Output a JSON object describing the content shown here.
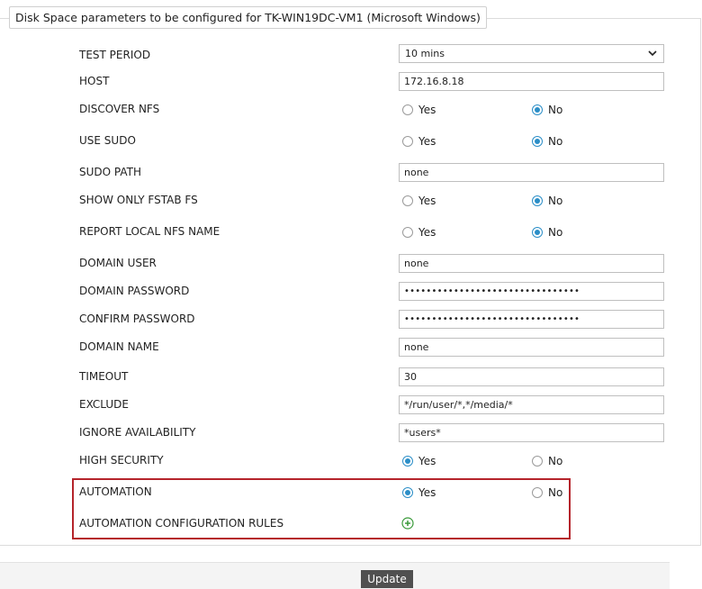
{
  "panel": {
    "title": "Disk Space parameters to be configured for TK-WIN19DC-VM1 (Microsoft Windows)"
  },
  "form": {
    "test_period": {
      "label": "TEST PERIOD",
      "value": "10 mins"
    },
    "host": {
      "label": "HOST",
      "value": "172.16.8.18"
    },
    "discover_nfs": {
      "label": "DISCOVER NFS",
      "yes": "Yes",
      "no": "No",
      "selected": "No"
    },
    "use_sudo": {
      "label": "USE SUDO",
      "yes": "Yes",
      "no": "No",
      "selected": "No"
    },
    "sudo_path": {
      "label": "SUDO PATH",
      "value": "none"
    },
    "show_only_fstab_fs": {
      "label": "SHOW ONLY FSTAB FS",
      "yes": "Yes",
      "no": "No",
      "selected": "No"
    },
    "report_local_nfs_name": {
      "label": "REPORT LOCAL NFS NAME",
      "yes": "Yes",
      "no": "No",
      "selected": "No"
    },
    "domain_user": {
      "label": "DOMAIN USER",
      "value": "none"
    },
    "domain_password": {
      "label": "DOMAIN PASSWORD",
      "value": "••••••••••••••••••••••••••••••••"
    },
    "confirm_password": {
      "label": "CONFIRM PASSWORD",
      "value": "••••••••••••••••••••••••••••••••"
    },
    "domain_name": {
      "label": "DOMAIN NAME",
      "value": "none"
    },
    "timeout": {
      "label": "TIMEOUT",
      "value": "30"
    },
    "exclude": {
      "label": "EXCLUDE",
      "value": "*/run/user/*,*/media/*"
    },
    "ignore_availability": {
      "label": "IGNORE AVAILABILITY",
      "value": "*users*"
    },
    "high_security": {
      "label": "HIGH SECURITY",
      "yes": "Yes",
      "no": "No",
      "selected": "Yes"
    },
    "automation": {
      "label": "AUTOMATION",
      "yes": "Yes",
      "no": "No",
      "selected": "Yes"
    },
    "automation_rules": {
      "label": "AUTOMATION CONFIGURATION RULES",
      "icon": "add-circle-icon"
    }
  },
  "footer": {
    "update_label": "Update"
  },
  "colors": {
    "radio_selected": "#2b8ec7",
    "highlight_border": "#b5242b",
    "add_icon": "#3a9a3a",
    "button_bg": "#505050"
  }
}
